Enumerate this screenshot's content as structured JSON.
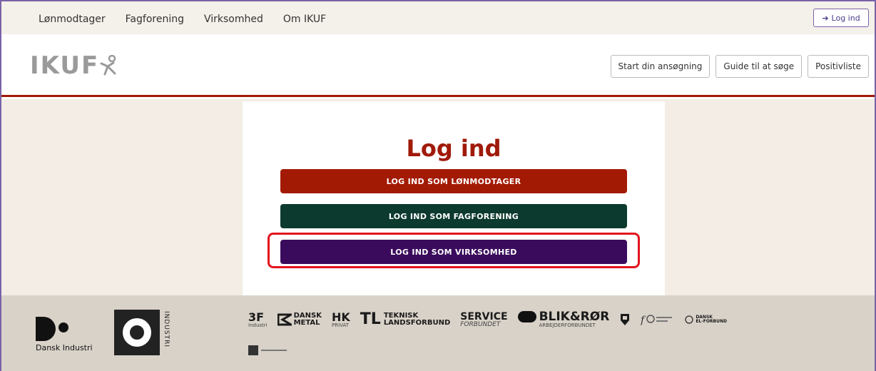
{
  "topnav": {
    "links": [
      "Lønmodtager",
      "Fagforening",
      "Virksomhed",
      "Om IKUF"
    ],
    "login_label": "Log ind"
  },
  "header": {
    "logo": "IKUF",
    "buttons": [
      "Start din ansøgning",
      "Guide til at søge",
      "Positivliste"
    ]
  },
  "main": {
    "title": "Log ind",
    "buttons": [
      {
        "label": "LOG IND SOM LØNMODTAGER",
        "color": "#a31a04"
      },
      {
        "label": "LOG IND SOM FAGFORENING",
        "color": "#0d3a2e"
      },
      {
        "label": "LOG IND SOM VIRKSOMHED",
        "color": "#3a0b5c"
      }
    ],
    "highlight_color": "#e3141e"
  },
  "footer": {
    "di_label": "Dansk Industri",
    "co_label": "INDUSTRI",
    "unions": {
      "f3": "3F",
      "f3_sub": "Industri",
      "danskmetal_1": "DANSK",
      "danskmetal_2": "METAL",
      "hk": "HK",
      "hk_sub": "PRIVAT",
      "tl": "TL",
      "tl_1": "TEKNISK",
      "tl_2": "LANDSFORBUND",
      "service_1": "SERVICE",
      "service_2": "FORBUNDET",
      "blik": "BLIK&RØR",
      "blik_sub": "ARBEJDERFORBUNDET",
      "elf_1": "DANSK",
      "elf_2": "EL-FORBUND"
    }
  }
}
